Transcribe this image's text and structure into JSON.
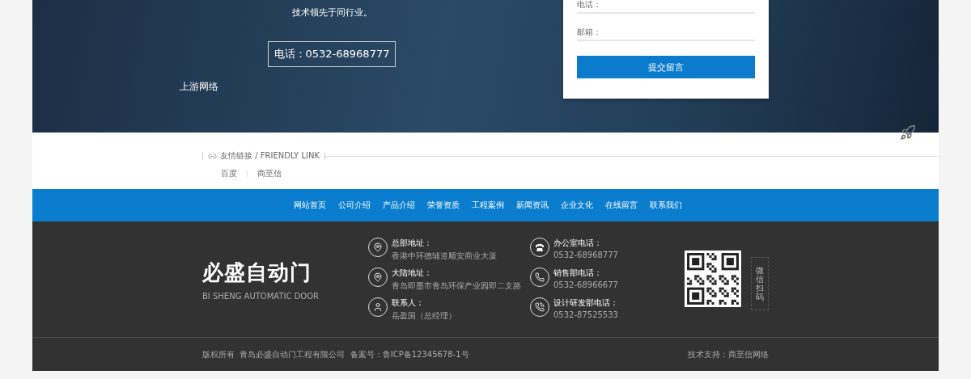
{
  "hero": {
    "intro": "技术领先于同行业。",
    "phone": "电话：0532-68968777",
    "brand": "上游网络"
  },
  "message_form": {
    "fields": [
      {
        "label": "电话："
      },
      {
        "label": "邮箱："
      }
    ],
    "submit": "提交留言"
  },
  "friendly_links": {
    "title": "友情链接 / FRIENDLY LINK",
    "links": [
      "百度",
      "商至信"
    ]
  },
  "nav": [
    "网站首页",
    "公司介绍",
    "产品介绍",
    "荣誉资质",
    "工程案例",
    "新闻资讯",
    "企业文化",
    "在线留言",
    "联系我们"
  ],
  "footer": {
    "logo": {
      "name": "必盛自动门",
      "subtitle": "BI SHENG AUTOMATIC DOOR"
    },
    "contacts": [
      {
        "kind": "location",
        "label": "总部地址：",
        "value": "香港中环德辅道顺安商业大厦"
      },
      {
        "kind": "location",
        "label": "大陆地址：",
        "value": "青岛即墨市青岛环保产业园即二支路"
      },
      {
        "kind": "person",
        "label": "联系人：",
        "value": "岳盈国（总经理）"
      },
      {
        "kind": "telephone",
        "label": "办公室电话：",
        "value": "0532-68968777"
      },
      {
        "kind": "phone",
        "label": "销售部电话：",
        "value": "0532-68966677"
      },
      {
        "kind": "phone-call",
        "label": "设计研发部电话：",
        "value": "0532-87525533"
      }
    ],
    "qr_caption": "微信扫码"
  },
  "bottom_bar": {
    "copyright": "版权所有  青岛必盛自动门工程有限公司  备案号：鲁ICP备12345678-1号",
    "support": "技术支持：商至信网络"
  }
}
